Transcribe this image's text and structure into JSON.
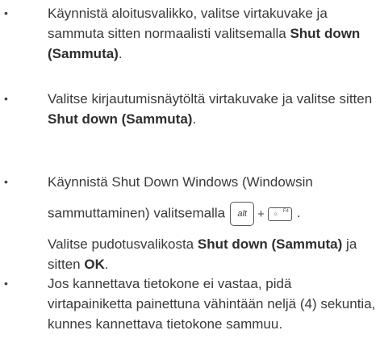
{
  "items": [
    {
      "bullet": "•",
      "pre": "Käynnistä aloitusvalikko, valitse virtakuvake ja sammuta sitten normaalisti valitsemalla ",
      "bold": "Shut down (Sammuta)",
      "post": "."
    },
    {
      "bullet": "•",
      "pre": "Valitse kirjautumisnäytöltä virtakuvake ja valitse sitten ",
      "bold": "Shut down (Sammuta)",
      "post": "."
    },
    {
      "bullet": "•",
      "line1": "Käynnistä Shut Down Windows (Windowsin",
      "line2_pre": "sammuttaminen) valitsemalla",
      "key_alt": "alt",
      "plus": "+",
      "key_f4_label": "F4",
      "key_f4_icon": "☼",
      "line2_post": ".",
      "line3_pre": "Valitse pudotusvalikosta ",
      "line3_bold": "Shut down (Sammuta)",
      "line3_mid": " ja sitten ",
      "line3_bold2": "OK",
      "line3_post": "."
    },
    {
      "bullet": "•",
      "text": "Jos kannettava tietokone ei vastaa, pidä virtapainiketta painettuna vähintään neljä (4) sekuntia, kunnes kannettava tietokone sammuu."
    }
  ]
}
